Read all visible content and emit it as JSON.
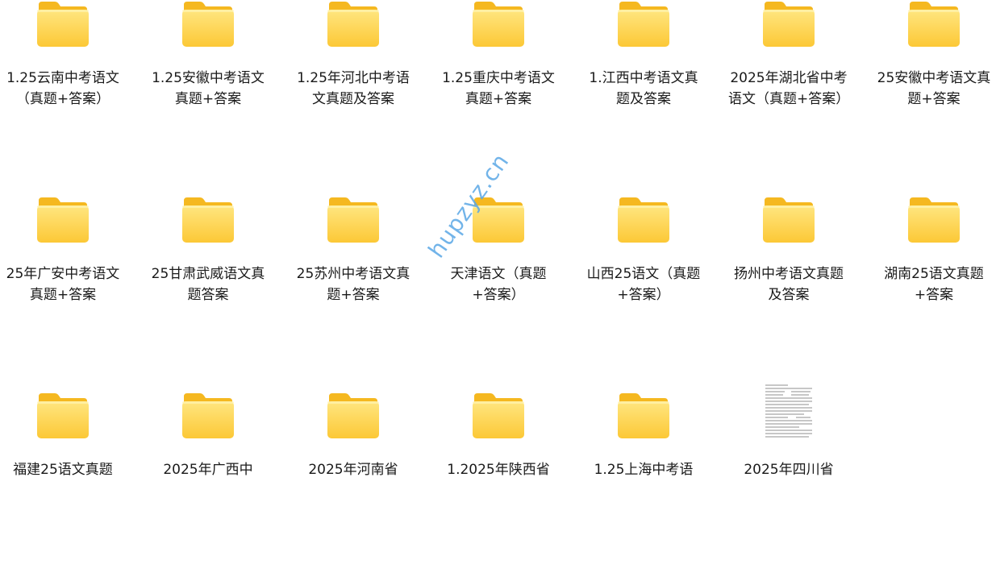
{
  "items": [
    {
      "label": "1.25云南中考语文（真题+答案）",
      "type": "folder"
    },
    {
      "label": "1.25安徽中考语文真题+答案",
      "type": "folder"
    },
    {
      "label": "1.25年河北中考语文真题及答案",
      "type": "folder"
    },
    {
      "label": "1.25重庆中考语文真题+答案",
      "type": "folder"
    },
    {
      "label": "1.江西中考语文真题及答案",
      "type": "folder"
    },
    {
      "label": "2025年湖北省中考语文（真题+答案）",
      "type": "folder"
    },
    {
      "label": "25安徽中考语文真题+答案",
      "type": "folder"
    },
    {
      "label": "25年广安中考语文真题+答案",
      "type": "folder"
    },
    {
      "label": "25甘肃武威语文真题答案",
      "type": "folder"
    },
    {
      "label": "25苏州中考语文真题+答案",
      "type": "folder"
    },
    {
      "label": "天津语文（真题+答案）",
      "type": "folder"
    },
    {
      "label": "山西25语文（真题+答案）",
      "type": "folder"
    },
    {
      "label": "扬州中考语文真题及答案",
      "type": "folder"
    },
    {
      "label": "湖南25语文真题+答案",
      "type": "folder"
    },
    {
      "label": "福建25语文真题",
      "type": "folder"
    },
    {
      "label": "2025年广西中",
      "type": "folder"
    },
    {
      "label": "2025年河南省",
      "type": "folder"
    },
    {
      "label": "1.2025年陕西省",
      "type": "folder"
    },
    {
      "label": "1.25上海中考语",
      "type": "folder"
    },
    {
      "label": "2025年四川省",
      "type": "document"
    }
  ],
  "watermark": "hupzyz.cn",
  "colors": {
    "folder_back": "#f5b820",
    "folder_front_top": "#ffe680",
    "folder_front_bottom": "#fcc836",
    "label": "#1a1a1a",
    "watermark": "#5aa7e6"
  }
}
